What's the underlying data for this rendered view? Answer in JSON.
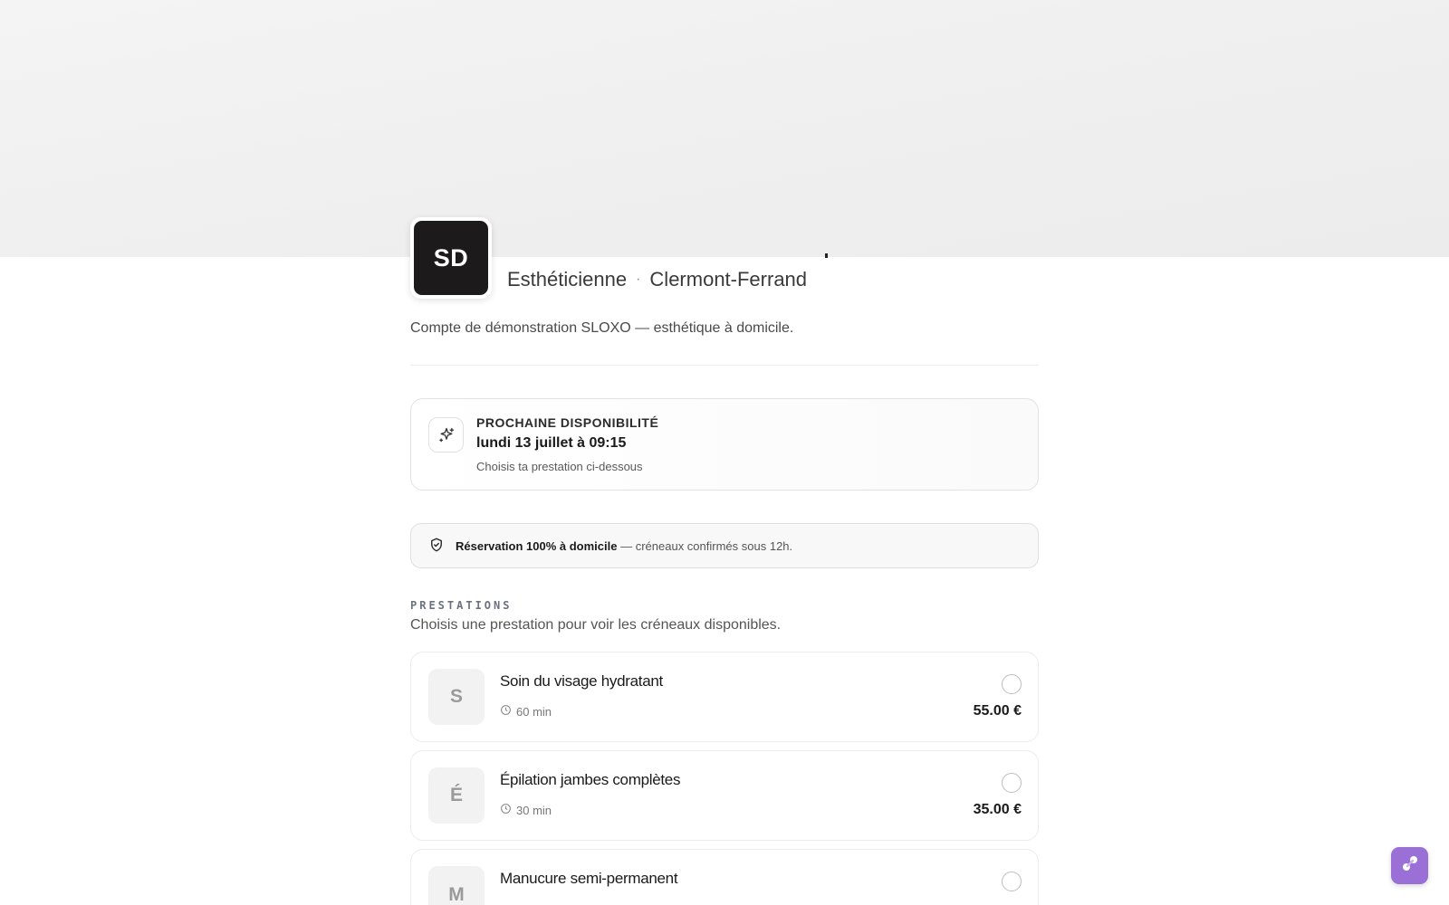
{
  "profile": {
    "initials": "SD",
    "profession": "Esthéticienne",
    "separator": "·",
    "city": "Clermont-Ferrand",
    "description": "Compte de démonstration SLOXO — esthétique à domicile."
  },
  "availability": {
    "label": "PROCHAINE DISPONIBILITÉ",
    "date": "lundi 13 juillet à 09:15",
    "hint": "Choisis ta prestation ci-dessous",
    "icon": "sparkles-icon"
  },
  "reservation": {
    "bold": "Réservation 100% à domicile",
    "rest": "— créneaux confirmés sous 12h.",
    "icon": "shield-check-icon"
  },
  "services_section": {
    "title": "PRESTATIONS",
    "subtitle": "Choisis une prestation pour voir les créneaux disponibles."
  },
  "services": [
    {
      "initial": "S",
      "name": "Soin du visage hydratant",
      "duration": "60 min",
      "price": "55.00 €"
    },
    {
      "initial": "É",
      "name": "Épilation jambes complètes",
      "duration": "30 min",
      "price": "35.00 €"
    },
    {
      "initial": "M",
      "name": "Manucure semi-permanent",
      "duration": "",
      "price": ""
    }
  ],
  "colors": {
    "accent": "#9a6fd6",
    "avatar_bg": "#1c1a1a"
  }
}
